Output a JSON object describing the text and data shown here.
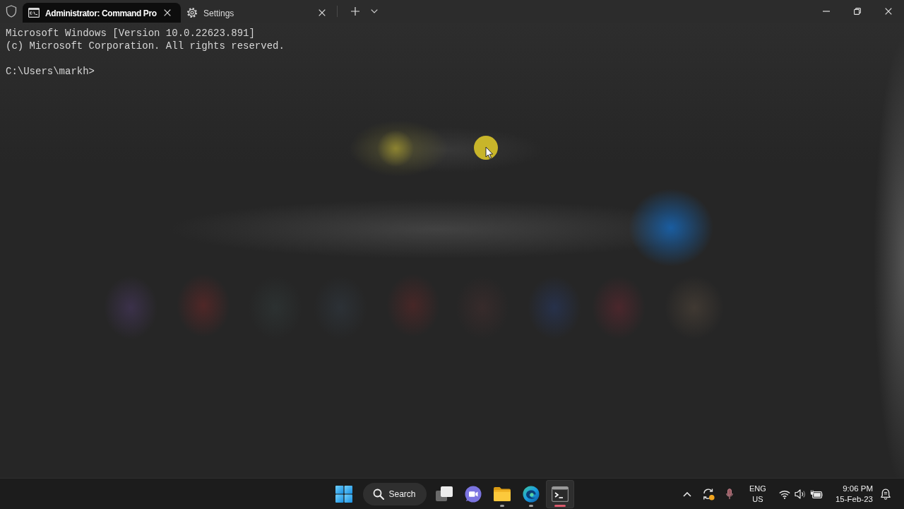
{
  "window": {
    "tabs": [
      {
        "kind": "terminal",
        "label": "Administrator: Command Pro",
        "selected": true
      },
      {
        "kind": "settings",
        "label": "Settings",
        "selected": false
      }
    ]
  },
  "terminal": {
    "output": [
      "Microsoft Windows [Version 10.0.22623.891]",
      "(c) Microsoft Corporation. All rights reserved."
    ],
    "prompt": "C:\\Users\\markh>"
  },
  "taskbar": {
    "search": {
      "label": "Search"
    },
    "apps": [
      {
        "kind": "taskview",
        "running": false,
        "active": false
      },
      {
        "kind": "chat",
        "running": false,
        "active": false
      },
      {
        "kind": "explorer",
        "running": true,
        "active": false
      },
      {
        "kind": "browser",
        "running": true,
        "active": false
      },
      {
        "kind": "terminal",
        "running": true,
        "active": true
      }
    ],
    "tray": {
      "language": {
        "primary": "ENG",
        "secondary": "US"
      },
      "clock": {
        "time": "9:06 PM",
        "date": "15-Feb-23"
      }
    }
  }
}
